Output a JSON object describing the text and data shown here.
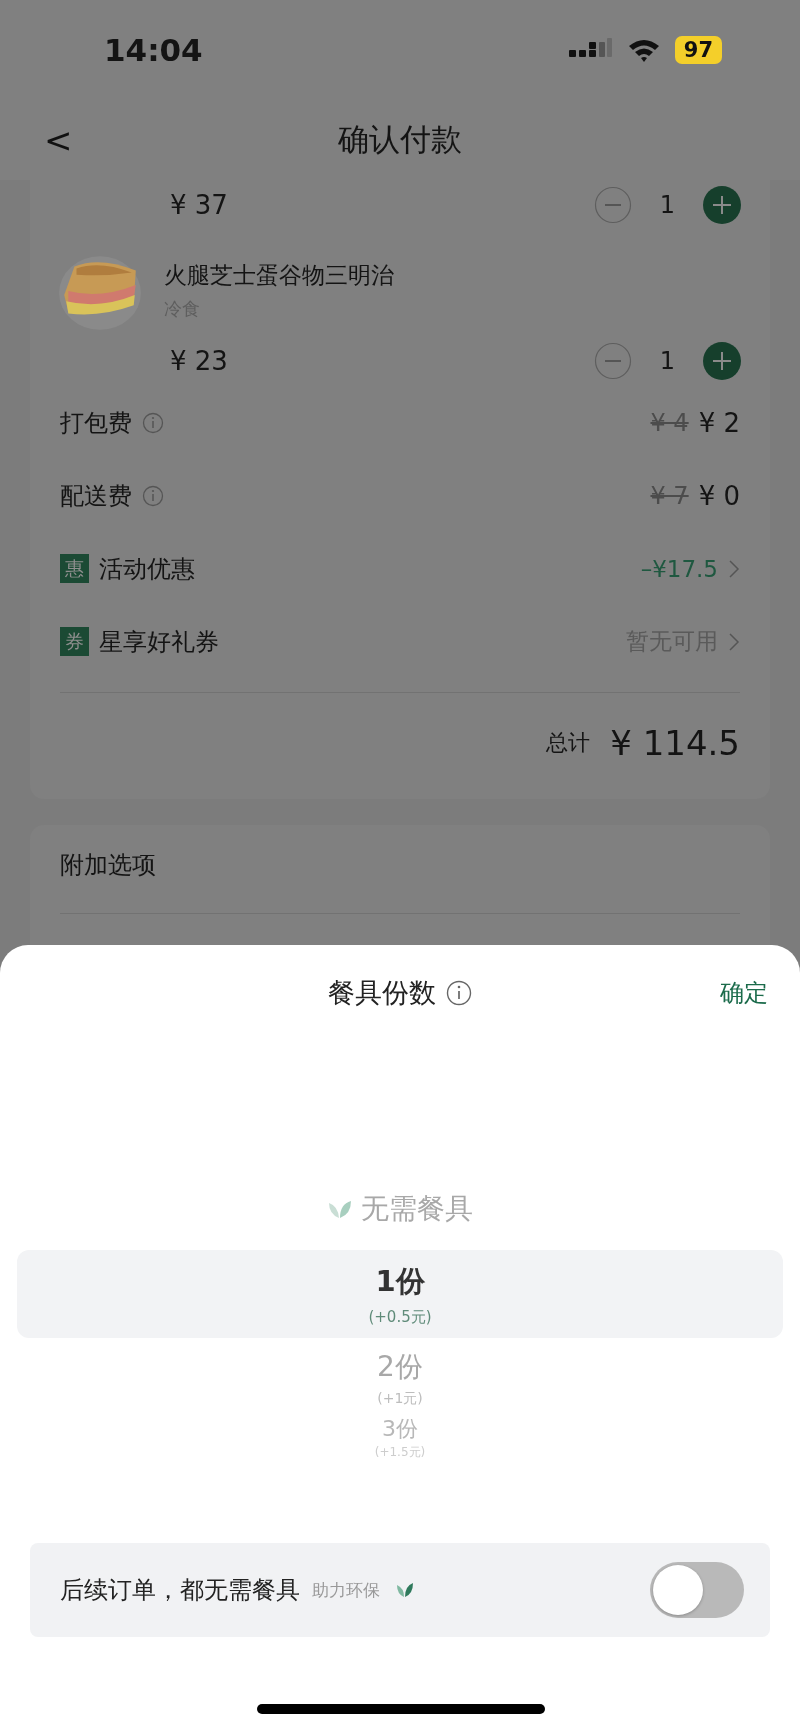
{
  "status_bar": {
    "time": "14:04",
    "battery": "97"
  },
  "nav": {
    "back": "<",
    "title": "确认付款"
  },
  "items": [
    {
      "price": "¥ 37",
      "count": "1"
    },
    {
      "name": "火腿芝士蛋谷物三明治",
      "category": "冷食",
      "price": "¥ 23",
      "count": "1",
      "kind": "picture"
    }
  ],
  "price_rows": [
    {
      "kind": "fee",
      "label": "打包费",
      "old_price": "¥ 4",
      "price": "¥ 2"
    },
    {
      "kind": "fee",
      "label": "配送费",
      "old_price": "¥ 7",
      "price": "¥ 0"
    },
    {
      "kind": "discount",
      "badge": "惠",
      "label": "活动优惠",
      "value": "–¥17.5"
    },
    {
      "kind": "coupon",
      "badge": "券",
      "label": "星享好礼券",
      "value": "暂无可用"
    }
  ],
  "total": {
    "label": "总计",
    "value": "¥ 114.5"
  },
  "extras": {
    "title": "附加选项"
  },
  "sheet": {
    "title": "餐具份数",
    "confirm": "确定",
    "options": [
      {
        "kind": "none",
        "label": "无需餐具",
        "selected": false
      },
      {
        "kind": "count",
        "label": "1份",
        "sub": "(+0.5元)",
        "selected": true
      },
      {
        "kind": "count",
        "label": "2份",
        "sub": "(+1元)",
        "selected": false
      },
      {
        "kind": "count",
        "label": "3份",
        "sub": "(+1.5元)",
        "selected": false
      }
    ],
    "preference": {
      "label": "后续订单，都无需餐具",
      "hint": "助力环保",
      "on": false
    }
  }
}
